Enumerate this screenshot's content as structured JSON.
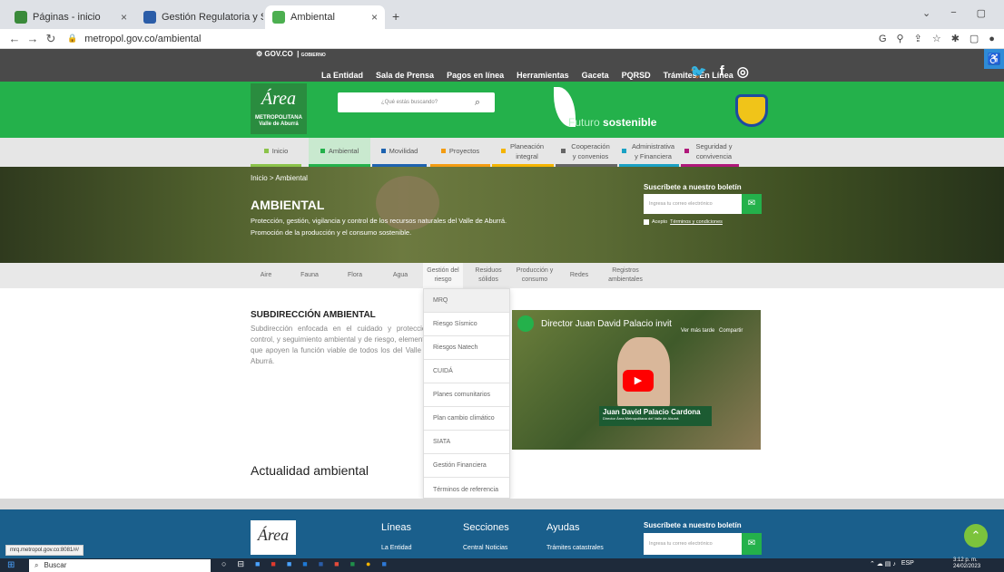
{
  "browser": {
    "tabs": [
      {
        "title": "Páginas - inicio",
        "color": "#3a8a3a"
      },
      {
        "title": "Gestión Regulatoria y Sancionato",
        "color": "#2b5da8"
      },
      {
        "title": "Ambiental",
        "color": "#4caf50"
      }
    ],
    "url": "metropol.gov.co/ambiental",
    "status_url": "mrq.metropol.gov.co:8081/#/"
  },
  "site": {
    "gov": "GOV.CO",
    "topnav": [
      "La Entidad",
      "Sala de Prensa",
      "Pagos en línea",
      "Herramientas",
      "Gaceta",
      "PQRSD",
      "Trámites En Línea"
    ],
    "logo_text": "Área",
    "logo_sub": "METROPOLITANA Valle de Aburrá",
    "search_placeholder": "¿Qué estás buscando?",
    "slogan_a": "Futuro",
    "slogan_b": "sostenible",
    "mainnav": [
      {
        "label": "Inicio",
        "color": "#8bc34a"
      },
      {
        "label": "Ambiental",
        "color": "#24b14b"
      },
      {
        "label": "Movilidad",
        "color": "#1e63b0"
      },
      {
        "label": "Proyectos",
        "color": "#f39c12"
      },
      {
        "label": "Planeación integral",
        "color": "#f4b400"
      },
      {
        "label": "Cooperación y convenios",
        "color": "#666666"
      },
      {
        "label": "Administrativa y Financiera",
        "color": "#1aa1c4"
      },
      {
        "label": "Seguridad y convivencia",
        "color": "#b0187a"
      }
    ],
    "breadcrumb": "Inicio > Ambiental",
    "hero_title": "AMBIENTAL",
    "hero_text_1": "Protección, gestión, vigilancia y control de los recursos naturales del Valle de Aburrá.",
    "hero_text_2": "Promoción de la producción y el consumo sostenible.",
    "newsletter_title": "Suscríbete a nuestro boletín",
    "newsletter_placeholder": "Ingresa tu correo electrónico",
    "accept": "Acepto",
    "terms": "Términos y condiciones",
    "subnav": [
      "Aire",
      "Fauna",
      "Flora",
      "Agua",
      "Gestión del riesgo",
      "Residuos sólidos",
      "Producción y consumo",
      "Redes",
      "Registros ambientales"
    ],
    "dropdown": [
      "MRQ",
      "Riesgo Sísmico",
      "Riesgos Natech",
      "CUIDÁ",
      "Planes comunitarios",
      "Plan cambio climático",
      "SIATA",
      "Gestión Financiera",
      "Términos de referencia"
    ],
    "section_title": "SUBDIRECCIÓN AMBIENTAL",
    "section_text": "Subdirección enfocada en el cuidado y protección, control, y seguimiento ambiental y de riesgo, elementos que apoyen la función viable de todos los del Valle de Aburrá.",
    "video_title": "Director Juan David Palacio invit",
    "video_watch": "Ver más tarde",
    "video_share": "Compartir",
    "video_name": "Juan David Palacio Cardona",
    "video_role": "Director Área Metropolitana del Valle de Aburrá",
    "news_title": "Actualidad ambiental",
    "footer": {
      "col1": "Líneas",
      "col2": "Secciones",
      "col3": "Ayudas",
      "col1_item": "La Entidad",
      "col2_item": "Central Noticias",
      "col3_item": "Trámites catastrales",
      "newsletter": "Suscríbete a nuestro boletín",
      "placeholder": "Ingresa tu correo electrónico"
    }
  },
  "taskbar": {
    "search": "Buscar",
    "lang": "ESP",
    "time": "3:12 p. m.",
    "date": "24/02/2023"
  }
}
